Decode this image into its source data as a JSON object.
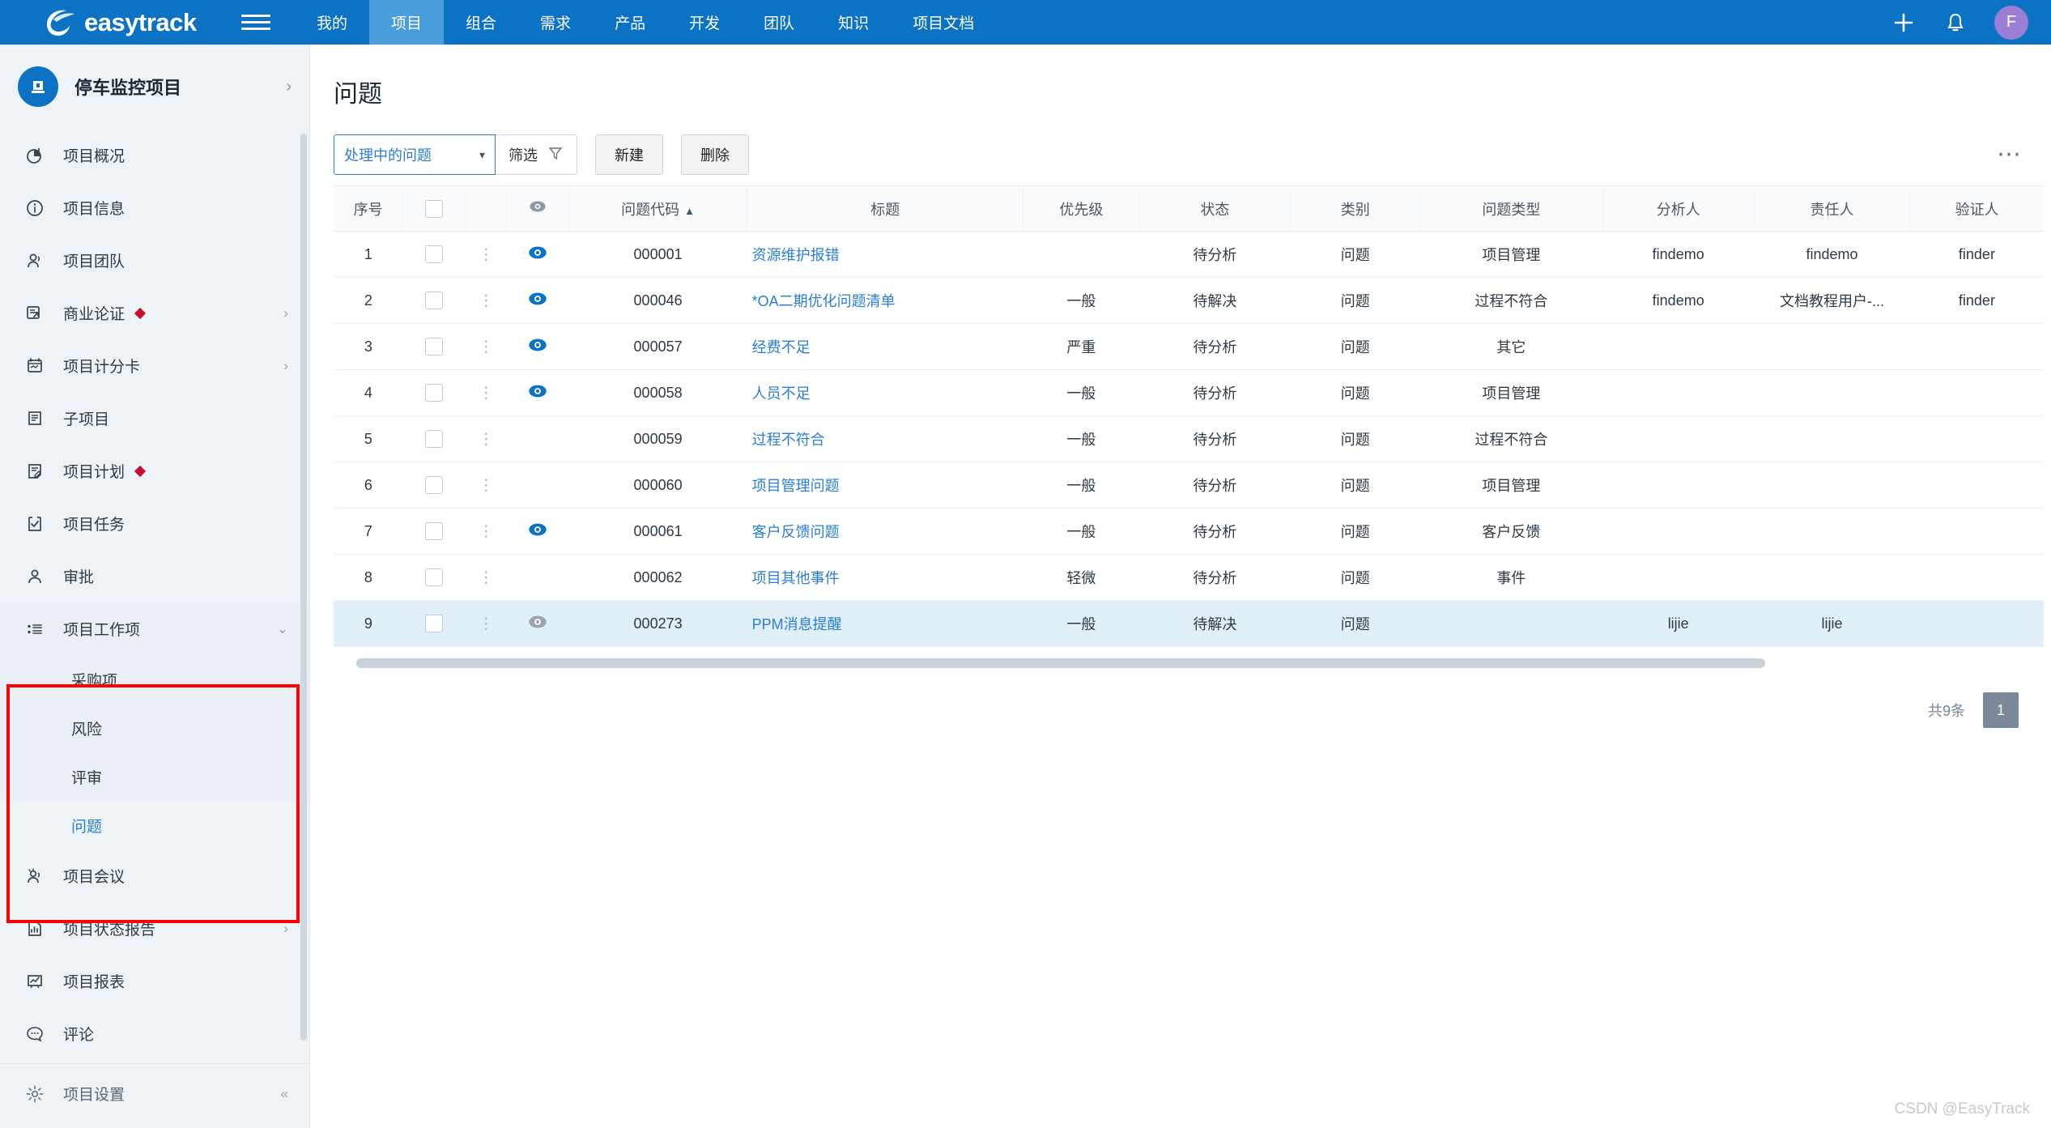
{
  "brand": {
    "name": "easytrack"
  },
  "topnav": {
    "menu_icon": "hamburger-icon",
    "items": [
      {
        "label": "我的",
        "active": false
      },
      {
        "label": "项目",
        "active": true
      },
      {
        "label": "组合",
        "active": false
      },
      {
        "label": "需求",
        "active": false
      },
      {
        "label": "产品",
        "active": false
      },
      {
        "label": "开发",
        "active": false
      },
      {
        "label": "团队",
        "active": false
      },
      {
        "label": "知识",
        "active": false
      },
      {
        "label": "项目文档",
        "active": false
      }
    ],
    "add_icon": "plus-icon",
    "bell_icon": "bell-icon",
    "avatar_initial": "F",
    "avatar_color": "#9b7fd4",
    "background": "#0b72c4",
    "active_background": "#4a9ddb"
  },
  "sidebar": {
    "project_name": "停车监控项目",
    "project_icon": "building-icon",
    "expand_icon": "chevron-right-icon",
    "items": [
      {
        "label": "项目概况",
        "icon": "pie-chart-icon",
        "dot": false,
        "arrow": ""
      },
      {
        "label": "项目信息",
        "icon": "info-circle-icon",
        "dot": false,
        "arrow": ""
      },
      {
        "label": "项目团队",
        "icon": "team-icon",
        "dot": false,
        "arrow": ""
      },
      {
        "label": "商业论证",
        "icon": "business-case-icon",
        "dot": true,
        "arrow": "›"
      },
      {
        "label": "项目计分卡",
        "icon": "scorecard-icon",
        "dot": false,
        "arrow": "›"
      },
      {
        "label": "子项目",
        "icon": "subproject-icon",
        "dot": false,
        "arrow": ""
      },
      {
        "label": "项目计划",
        "icon": "plan-edit-icon",
        "dot": true,
        "arrow": ""
      },
      {
        "label": "项目任务",
        "icon": "task-check-icon",
        "dot": false,
        "arrow": ""
      },
      {
        "label": "审批",
        "icon": "approval-person-icon",
        "dot": false,
        "arrow": ""
      }
    ],
    "workitem_group": {
      "label": "项目工作项",
      "icon": "list-bullet-icon",
      "arrow": "chevron-down-icon",
      "children": [
        {
          "label": "采购项",
          "current": false
        },
        {
          "label": "风险",
          "current": false
        },
        {
          "label": "评审",
          "current": false
        },
        {
          "label": "问题",
          "current": true
        }
      ]
    },
    "items_after": [
      {
        "label": "项目会议",
        "icon": "meeting-icon",
        "dot": false,
        "arrow": ""
      },
      {
        "label": "项目状态报告",
        "icon": "report-bar-icon",
        "dot": false,
        "arrow": "›"
      },
      {
        "label": "项目报表",
        "icon": "chart-board-icon",
        "dot": false,
        "arrow": ""
      },
      {
        "label": "评论",
        "icon": "comment-icon",
        "dot": false,
        "arrow": ""
      },
      {
        "label": "项目设置",
        "icon": "gear-icon",
        "dot": false,
        "arrow": "«"
      }
    ],
    "highlight_color": "#ff0000"
  },
  "page": {
    "title": "问题",
    "toolbar": {
      "filter_select_value": "处理中的问题",
      "filter_select_caret": "▾",
      "filter_label": "筛选",
      "filter_icon": "funnel-icon",
      "new_label": "新建",
      "delete_label": "删除",
      "more_icon": "ellipsis-icon"
    },
    "table": {
      "columns": [
        "序号",
        "",
        "",
        "",
        "问题代码",
        "标题",
        "优先级",
        "状态",
        "类别",
        "问题类型",
        "分析人",
        "责任人",
        "验证人"
      ],
      "sort_column": "问题代码",
      "sort_direction": "▲",
      "rows": [
        {
          "no": "1",
          "eye": "active",
          "code": "000001",
          "title": "资源维护报错",
          "priority": "",
          "status": "待分析",
          "category": "问题",
          "type": "项目管理",
          "analyst": "findemo",
          "owner": "findemo",
          "verifier": "finder",
          "selected": false
        },
        {
          "no": "2",
          "eye": "active",
          "code": "000046",
          "title": "*OA二期优化问题清单",
          "priority": "一般",
          "status": "待解决",
          "category": "问题",
          "type": "过程不符合",
          "analyst": "findemo",
          "owner": "文档教程用户-...",
          "verifier": "finder",
          "selected": false
        },
        {
          "no": "3",
          "eye": "active",
          "code": "000057",
          "title": "经费不足",
          "priority": "严重",
          "status": "待分析",
          "category": "问题",
          "type": "其它",
          "analyst": "",
          "owner": "",
          "verifier": "",
          "selected": false
        },
        {
          "no": "4",
          "eye": "active",
          "code": "000058",
          "title": "人员不足",
          "priority": "一般",
          "status": "待分析",
          "category": "问题",
          "type": "项目管理",
          "analyst": "",
          "owner": "",
          "verifier": "",
          "selected": false
        },
        {
          "no": "5",
          "eye": "none",
          "code": "000059",
          "title": "过程不符合",
          "priority": "一般",
          "status": "待分析",
          "category": "问题",
          "type": "过程不符合",
          "analyst": "",
          "owner": "",
          "verifier": "",
          "selected": false
        },
        {
          "no": "6",
          "eye": "none",
          "code": "000060",
          "title": "项目管理问题",
          "priority": "一般",
          "status": "待分析",
          "category": "问题",
          "type": "项目管理",
          "analyst": "",
          "owner": "",
          "verifier": "",
          "selected": false
        },
        {
          "no": "7",
          "eye": "active",
          "code": "000061",
          "title": "客户反馈问题",
          "priority": "一般",
          "status": "待分析",
          "category": "问题",
          "type": "客户反馈",
          "analyst": "",
          "owner": "",
          "verifier": "",
          "selected": false
        },
        {
          "no": "8",
          "eye": "none",
          "code": "000062",
          "title": "项目其他事件",
          "priority": "轻微",
          "status": "待分析",
          "category": "问题",
          "type": "事件",
          "analyst": "",
          "owner": "",
          "verifier": "",
          "selected": false
        },
        {
          "no": "9",
          "eye": "muted",
          "code": "000273",
          "title": "PPM消息提醒",
          "priority": "一般",
          "status": "待解决",
          "category": "问题",
          "type": "",
          "analyst": "lijie",
          "owner": "lijie",
          "verifier": "",
          "selected": true
        }
      ]
    },
    "pagination": {
      "total_label": "共9条",
      "current_page": "1"
    }
  },
  "watermark": "CSDN @EasyTrack"
}
